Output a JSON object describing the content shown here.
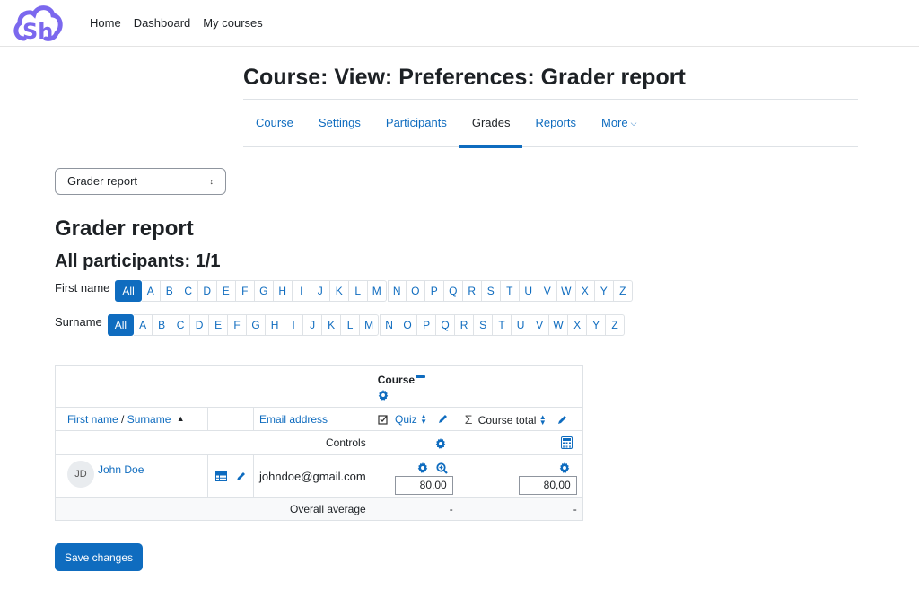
{
  "navbar": {
    "logo_alt": "SH cloud logo",
    "links": [
      "Home",
      "Dashboard",
      "My courses"
    ]
  },
  "page": {
    "title": "Course: View: Preferences: Grader report",
    "tabs": [
      {
        "label": "Course",
        "active": false
      },
      {
        "label": "Settings",
        "active": false
      },
      {
        "label": "Participants",
        "active": false
      },
      {
        "label": "Grades",
        "active": true
      },
      {
        "label": "Reports",
        "active": false
      },
      {
        "label": "More",
        "active": false
      }
    ]
  },
  "report_select": {
    "selected": "Grader report"
  },
  "headings": {
    "report": "Grader report",
    "participants": "All participants: 1/1"
  },
  "initials": {
    "first_name_label": "First name",
    "surname_label": "Surname",
    "all_label": "All",
    "letters": [
      "A",
      "B",
      "C",
      "D",
      "E",
      "F",
      "G",
      "H",
      "I",
      "J",
      "K",
      "L",
      "M",
      "N",
      "O",
      "P",
      "Q",
      "R",
      "S",
      "T",
      "U",
      "V",
      "W",
      "X",
      "Y",
      "Z"
    ]
  },
  "table": {
    "category_header": "Course",
    "columns": {
      "first_name": "First name",
      "separator": " / ",
      "surname": "Surname",
      "email": "Email address",
      "quiz": "Quiz",
      "course_total": "Course total"
    },
    "controls_label": "Controls",
    "rows": [
      {
        "initials": "JD",
        "name": "John Doe",
        "email": "johndoe@gmail.com",
        "quiz_grade": "80,00",
        "course_total": "80,00"
      }
    ],
    "overall_average_label": "Overall average",
    "overall_quiz": "-",
    "overall_total": "-"
  },
  "save_button": "Save changes",
  "colors": {
    "accent": "#0f6cbf",
    "logo": "#7b68ee",
    "text": "#1d2125"
  }
}
